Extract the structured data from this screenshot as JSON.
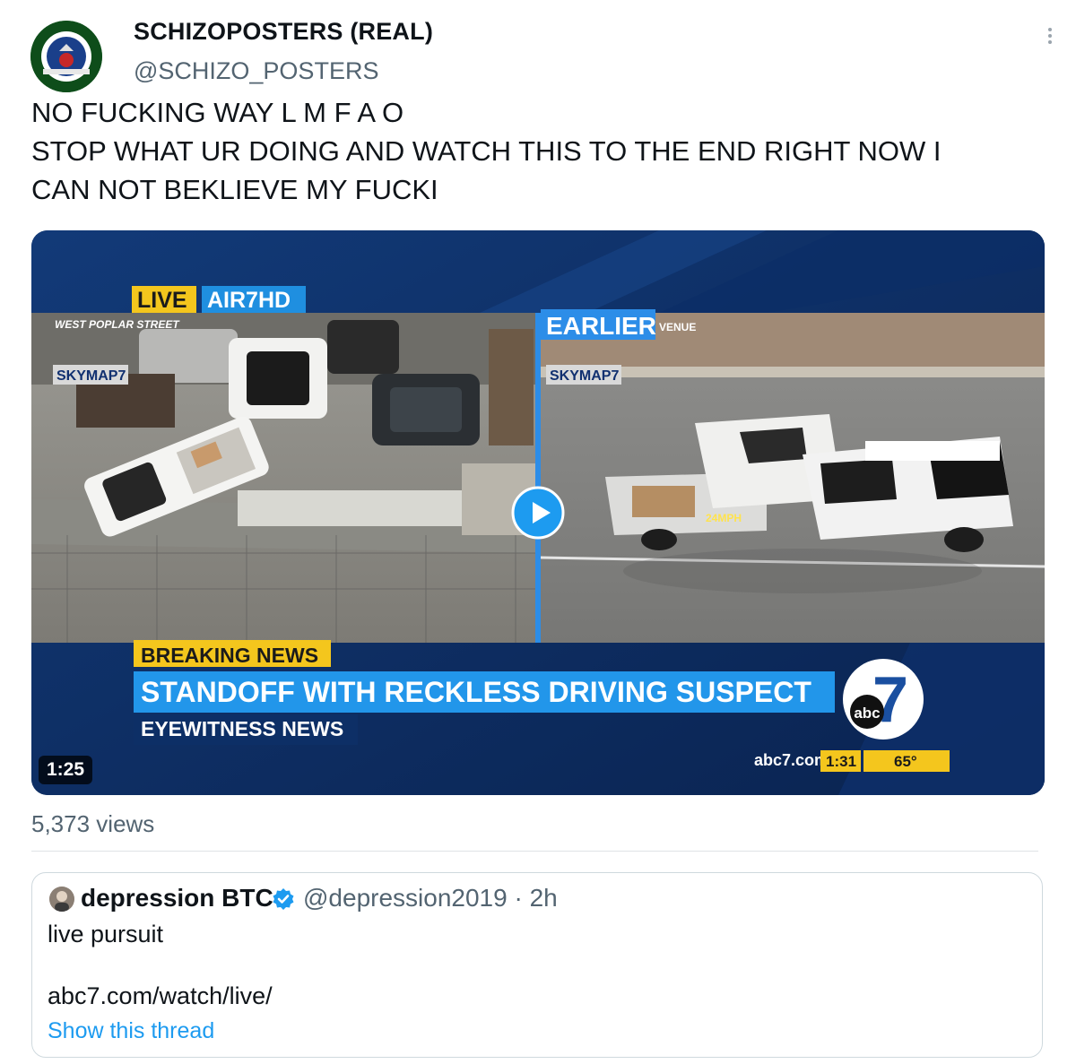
{
  "tweet": {
    "display_name": "SCHIZOPOSTERS (REAL)",
    "handle": "@SCHIZO_POSTERS",
    "text": "NO FUCKING WAY L M F A O\nSTOP WHAT UR DOING AND WATCH THIS TO THE END RIGHT NOW I\nCAN NOT BEKLIEVE MY FUCKI",
    "avatar_text": "SCHIZO POSTERS",
    "more_icon": "more-vertical-icon",
    "views": "5,373 views"
  },
  "video": {
    "duration": "1:25",
    "play_icon": "play-icon",
    "overlay": {
      "live": "LIVE",
      "air": "AIR7HD",
      "street": "WEST POPLAR STREET",
      "skymap_left": "SKYMAP7",
      "earlier": "EARLIER",
      "avenue": "VENUE",
      "skymap_right": "SKYMAP7",
      "speed": "24MPH",
      "breaking": "BREAKING NEWS",
      "headline": "STANDOFF WITH RECKLESS DRIVING SUSPECT",
      "show": "EYEWITNESS NEWS",
      "site": "abc7.com",
      "time": "1:31",
      "temp": "65°",
      "logo_abc": "abc",
      "logo_seven": "7"
    }
  },
  "quote": {
    "name": "depression BTC",
    "verified_icon": "verified-badge-icon",
    "handle_time": "@depression2019 · 2h",
    "text": "live pursuit",
    "link": "abc7.com/watch/live/",
    "show_thread": "Show this thread"
  },
  "colors": {
    "link_blue": "#1d9bf0",
    "muted": "#536471",
    "news_yellow": "#f4c61d",
    "news_blue": "#1f8fe0"
  }
}
